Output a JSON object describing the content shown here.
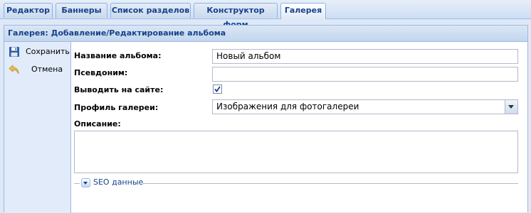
{
  "tabs": [
    {
      "label": "Редактор"
    },
    {
      "label": "Баннеры"
    },
    {
      "label": "Список разделов"
    },
    {
      "label": "Конструктор форм"
    },
    {
      "label": "Галерея",
      "active": true
    }
  ],
  "panel": {
    "title": "Галерея: Добавление/Редактирование альбома"
  },
  "toolbar": {
    "save_label": "Сохранить",
    "save_icon": "floppy-disk-icon",
    "cancel_label": "Отмена",
    "cancel_icon": "undo-arrow-icon"
  },
  "form": {
    "album_name_label": "Название альбома:",
    "album_name_value": "Новый альбом",
    "alias_label": "Псевдоним:",
    "alias_value": "",
    "show_on_site_label": "Выводить на сайте:",
    "show_on_site_checked": true,
    "gallery_profile_label": "Профиль галереи:",
    "gallery_profile_value": "Изображения для фотогалереи",
    "description_label": "Описание:",
    "description_value": "",
    "seo_label": "SEO данные"
  },
  "colors": {
    "header_text": "#15428b",
    "border": "#99bbe8",
    "sidebar_bg": "#e1ebf9"
  }
}
